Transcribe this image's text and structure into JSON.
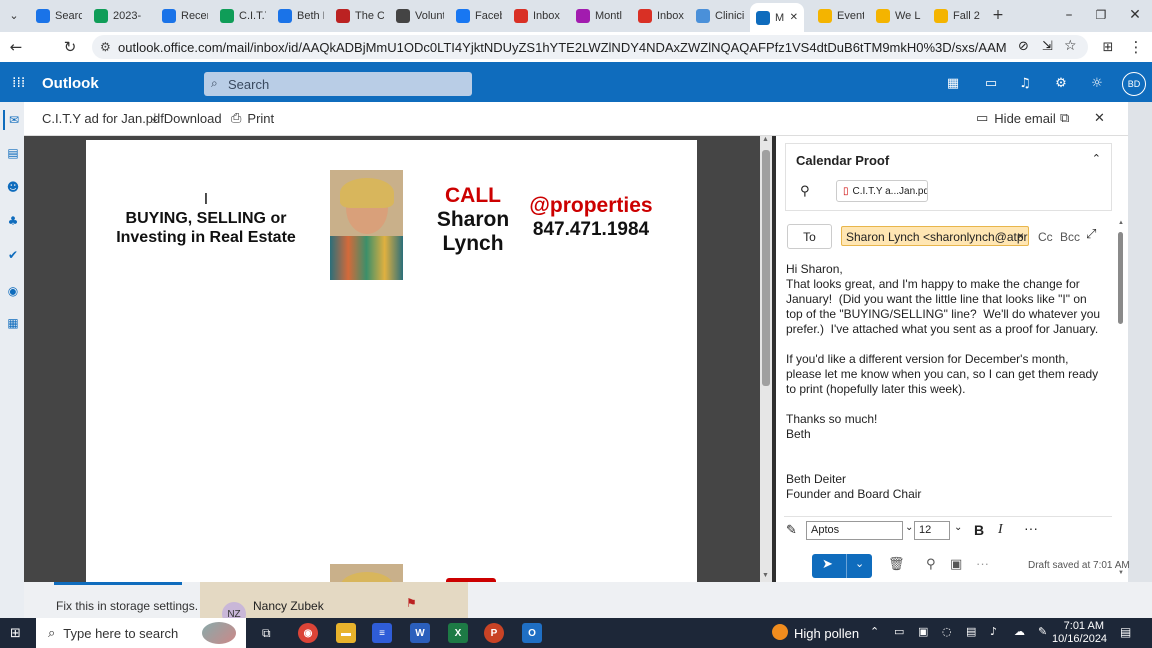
{
  "browser": {
    "tabs": [
      {
        "label": "Searc",
        "icon": "google-drive-icon",
        "color": "#1a73e8"
      },
      {
        "label": "2023-",
        "icon": "google-sheets-icon",
        "color": "#0f9d58"
      },
      {
        "label": "Recen",
        "icon": "google-drive-icon",
        "color": "#1a73e8"
      },
      {
        "label": "C.I.T.Y",
        "icon": "google-sheets-icon",
        "color": "#0f9d58"
      },
      {
        "label": "Beth D",
        "icon": "calendar-icon",
        "color": "#1a73e8"
      },
      {
        "label": "The C",
        "icon": "ribbon-icon",
        "color": "#b22"
      },
      {
        "label": "Volunt",
        "icon": "volunteer-icon",
        "color": "#444"
      },
      {
        "label": "Faceb",
        "icon": "facebook-icon",
        "color": "#1877f2"
      },
      {
        "label": "Inbox",
        "icon": "gmail-icon",
        "color": "#d93025"
      },
      {
        "label": "Montl",
        "icon": "onenote-icon",
        "color": "#a21caf"
      },
      {
        "label": "Inbox",
        "icon": "gmail-icon",
        "color": "#d93025"
      },
      {
        "label": "Clinici",
        "icon": "cloud-icon",
        "color": "#4a90d9"
      },
      {
        "label": "M",
        "icon": "outlook-icon",
        "color": "#0f6cbd"
      },
      {
        "label": "Event",
        "icon": "bookmark-icon",
        "color": "#f4b400"
      },
      {
        "label": "We L",
        "icon": "bookmark-icon",
        "color": "#f4b400"
      },
      {
        "label": "Fall 2",
        "icon": "bookmark-icon",
        "color": "#f4b400"
      }
    ],
    "url": "outlook.office.com/mail/inbox/id/AAQkADBjMmU1ODc0LTI4YjktNDUyZS1hYTE2LWZlNDY4NDAxZWZlNQAQAFPfz1VS4dtDuB6tTM9mkH0%3D/sxs/AAMkADBjMmU1ODc0LTI4YjktNDUyZS1hYTE2"
  },
  "outlook": {
    "app_label": "Outlook",
    "search_placeholder": "Search",
    "avatar": "BD"
  },
  "preview": {
    "filename": "C.I.T.Y ad for Jan.pdf",
    "download": "Download",
    "print": "Print",
    "hide_email": "Hide email"
  },
  "ad": {
    "line1": "I",
    "line2": "BUYING, SELLING or",
    "line3": "Investing in Real Estate",
    "call": "CALL",
    "name1": "Sharon",
    "name2": "Lynch",
    "brand": "@properties",
    "phone": "847.471.1984",
    "call_color": "#cc0000"
  },
  "compose": {
    "subject": "Calendar Proof",
    "attachment": "C.I.T.Y a...Jan.pdf",
    "to_label": "To",
    "recipient": "Sharon Lynch <sharonlynch@atpr...",
    "cc": "Cc",
    "bcc": "Bcc",
    "body": [
      "Hi Sharon,",
      "That looks great, and I'm happy to make the change for January!  (Did you want the little line that looks like \"I\" on top of the \"BUYING/SELLING\" line?  We'll do whatever you prefer.)  I've attached what you sent as a proof for January.",
      "",
      "If you'd like a different version for December's month, please let me know when you can, so I can get them ready to print (hopefully later this week).",
      "",
      "Thanks so much!",
      "Beth",
      "",
      "",
      "Beth Deiter",
      "Founder and Board Chair"
    ],
    "font": "Aptos",
    "font_size": "12",
    "draft_status": "Draft saved at 7:01 AM"
  },
  "background": {
    "storage_notice": "Fix this in storage settings.",
    "avatar_initials": "NZ",
    "sender": "Nancy Zubek"
  },
  "taskbar": {
    "search": "Type here to search",
    "weather": "High pollen",
    "time": "7:01 AM",
    "date": "10/16/2024"
  }
}
